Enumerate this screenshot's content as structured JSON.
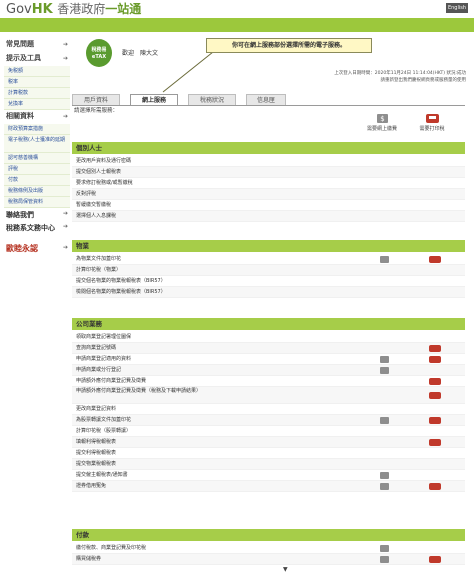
{
  "header": {
    "logo_gov": "Gov",
    "logo_hk": "HK",
    "logo_zh": "香港政府",
    "logo_zh2": "一站通",
    "lang_button": "English"
  },
  "sidebar": {
    "group1_title": "常見問題",
    "group2_title": "提示及工具",
    "group2_items": [
      "免税額",
      "税率",
      "計算税款",
      "兌換率"
    ],
    "group3_title": "相關資料",
    "group3_items": [
      "財政預算案措施",
      "電子稅務(人士獲准的延期",
      "認可慈善機構",
      "評稅",
      "付款",
      "稅務條例及出版",
      "稅務局保管資料"
    ],
    "contact": "聯絡我們",
    "service": "稅務系文務中心",
    "handwritten": "歐睦永認"
  },
  "user": {
    "badge_line1": "稅務易",
    "badge_line2": "eTAX",
    "greeting_label": "歡迎",
    "user_name": "陳大文",
    "tooltip": "你可在網上服務部份選擇所需的電子服務。",
    "last_login_label": "上次登入日期時間：",
    "last_login_value": "2020年11月24日 11:14:04(HKT) 狀況:成功",
    "last_login_note": "請重新登出我們慶祝網頁務或服務量的使用"
  },
  "tabs": [
    {
      "label": "用戶資料",
      "active": false
    },
    {
      "label": "網上服務",
      "active": true
    },
    {
      "label": "稅務狀況",
      "active": false
    },
    {
      "label": "信息匣",
      "active": false
    }
  ],
  "prompt": "請選擇所需服務：",
  "top_actions": [
    {
      "label": "需要網上繳費",
      "icon": "dollar-icon"
    },
    {
      "label": "需要打印稅",
      "icon": "car-icon"
    }
  ],
  "sections": [
    {
      "title": "個別人士",
      "rows": [
        {
          "label": "更改用戶資料及通行密碼",
          "dollar": false,
          "car": false
        },
        {
          "label": "提交個別人士報稅表",
          "dollar": false,
          "car": false
        },
        {
          "label": "要求修訂稅務或/或暫繳稅",
          "dollar": false,
          "car": false
        },
        {
          "label": "反對評稅",
          "dollar": false,
          "car": false
        },
        {
          "label": "暫緩繳交暫繳稅",
          "dollar": false,
          "car": false
        },
        {
          "label": "選擇個人入息課稅",
          "dollar": false,
          "car": false
        }
      ]
    },
    {
      "title": "物業",
      "rows": [
        {
          "label": "為物業文件加蓋印花",
          "dollar": true,
          "car": true
        },
        {
          "label": "計算印花稅（物業）",
          "dollar": false,
          "car": false
        },
        {
          "label": "提交個名物業的物業稅報稅表（BIR57）",
          "dollar": false,
          "car": false
        },
        {
          "label": "檢閱個名物業的物業稅報稅表（BIR57）",
          "dollar": false,
          "car": false
        }
      ]
    },
    {
      "title": "公司業務",
      "rows": [
        {
          "label": "領取商業登記署理位圖保",
          "dollar": false,
          "car": false
        },
        {
          "label": "查詢商業登記號碼",
          "dollar": false,
          "car": true
        },
        {
          "label": "申請商業登記適用的資料",
          "dollar": true,
          "car": true
        },
        {
          "label": "申請商業或分行登記",
          "dollar": true,
          "car": false
        },
        {
          "label": "申請額外應付商業登記費及徵費",
          "dollar": false,
          "car": true
        },
        {
          "label": "申請額外應付商業登記費及徵費（稅務及下載申請結果）",
          "dollar": false,
          "car": true,
          "two": true
        },
        {
          "label": "更改商業登記資料",
          "dollar": false,
          "car": false
        },
        {
          "label": "為股票轉讓文件加蓋印花",
          "dollar": true,
          "car": true
        },
        {
          "label": "計算印花稅（股票轉讓）",
          "dollar": false,
          "car": false
        },
        {
          "label": "填報利得稅報稅表",
          "dollar": false,
          "car": true
        },
        {
          "label": "提交利得稅報稅表",
          "dollar": false,
          "car": false
        },
        {
          "label": "提交物業稅報稅表",
          "dollar": false,
          "car": false
        },
        {
          "label": "提交僱主報稅表/通知書",
          "dollar": true,
          "car": false
        },
        {
          "label": "證券借用冤免",
          "dollar": true,
          "car": true
        }
      ]
    },
    {
      "title": "付款",
      "rows": [
        {
          "label": "繳付稅款、商業登記費及印花稅",
          "dollar": true,
          "car": false
        },
        {
          "label": "購買儲稅券",
          "dollar": true,
          "car": true
        }
      ]
    }
  ],
  "colors": {
    "brand_green": "#9cc83c",
    "section_green": "#a6cd49",
    "pay_icon": "#8e8e8e",
    "print_icon": "#c0392b",
    "tooltip_bg": "#fff8c5"
  }
}
